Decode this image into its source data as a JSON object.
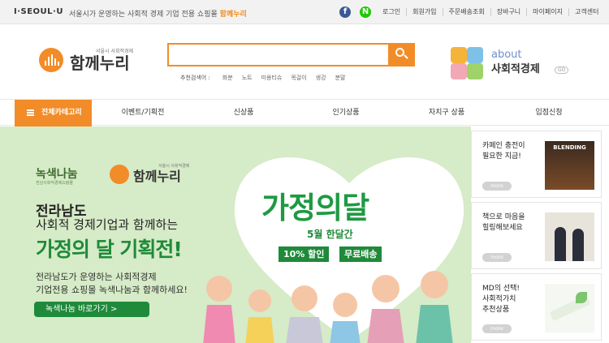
{
  "topbar": {
    "seoul_logo": "I·SEOUL·U",
    "desc_prefix": "서울시가 운영하는 사회적 경제 기업 전용 쇼핑몰",
    "desc_brand": "함께누리",
    "facebook_glyph": "f",
    "naver_glyph": "N",
    "links": [
      "로그인",
      "회원가입",
      "주문배송조회",
      "장바구니",
      "마이페이지",
      "고객센터"
    ]
  },
  "header": {
    "logo_small": "서울시 사회적경제",
    "logo_text": "함께누리",
    "search_placeholder": "",
    "keywords_label": "추천검색어 :",
    "keywords": [
      "화분",
      "노트",
      "미용티슈",
      "목걸이",
      "생강",
      "분말"
    ],
    "about_title": "about",
    "about_sub": "사회적경제",
    "about_go": "GO"
  },
  "nav": {
    "all_category": "전체카테고리",
    "items": [
      "이벤트/기획전",
      "신상품",
      "인기상품",
      "자치구 상품",
      "입점신청"
    ]
  },
  "banner": {
    "brand1": "녹색나눔",
    "brand1_sub": "전남사회적경제쇼핑몰",
    "brand2_small": "서울시 사회적경제",
    "brand2": "함께누리",
    "region": "전라남도",
    "line2": "사회적 경제기업과 함께하는",
    "title": "가정의 달 기획전!",
    "desc1": "전라남도가 운영하는 사회적경제",
    "desc2": "기업전용 쇼핑몰 녹색나눔과 함께하세요!",
    "cta": "녹색나눔 바로가기 >",
    "big_title": "가정의달",
    "month": "5월 한달간",
    "tag1": "10% 할인",
    "tag2": "무료배송"
  },
  "cards": [
    {
      "text": "카페인 충전이\n필요한 지금!",
      "more": "more",
      "img_label": "BLENDING"
    },
    {
      "text": "책으로 마음을\n힐링해보세요",
      "more": "more",
      "img_label": ""
    },
    {
      "text": "MD의 선택!\n사회적가치\n추천상품",
      "more": "more",
      "img_label": ""
    }
  ],
  "colors": {
    "accent": "#f28c28",
    "green": "#1e8a3a",
    "banner_bg": "#d6ebc7"
  }
}
